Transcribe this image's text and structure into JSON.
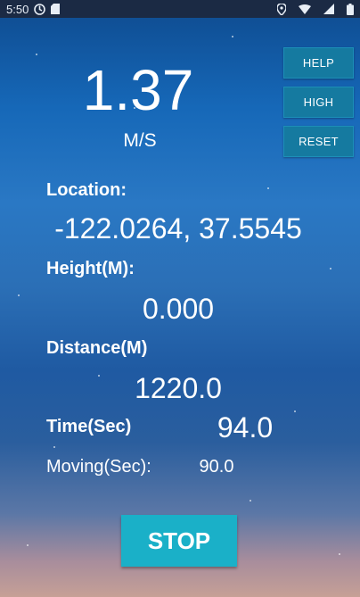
{
  "status_bar": {
    "time": "5:50",
    "icons_left": [
      "sync-icon",
      "sd-card-icon"
    ],
    "icons_right": [
      "location-icon",
      "wifi-icon",
      "signal-icon",
      "battery-icon"
    ]
  },
  "speed": {
    "value": "1.37",
    "unit": "M/S"
  },
  "side_buttons": {
    "help": "HELP",
    "high": "HIGH",
    "reset": "RESET"
  },
  "location": {
    "label": "Location:",
    "value": "-122.0264, 37.5545"
  },
  "height": {
    "label": "Height(M):",
    "value": "0.000"
  },
  "distance": {
    "label": "Distance(M)",
    "value": "1220.0"
  },
  "time": {
    "label": "Time(Sec)",
    "value": "94.0"
  },
  "moving": {
    "label": "Moving(Sec):",
    "value": "90.0"
  },
  "stop_button": "STOP",
  "colors": {
    "button_bg": "#157aa0",
    "stop_bg": "#1ab0c8",
    "status_bar_bg": "#1b2a44"
  }
}
